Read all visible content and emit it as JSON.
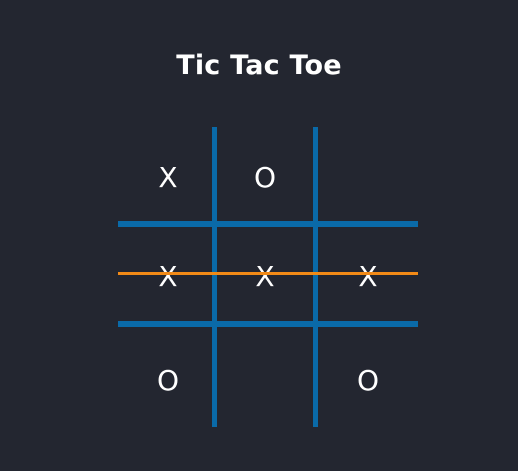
{
  "title": "Tic Tac Toe",
  "colors": {
    "background": "#232630",
    "grid": "#0a6aa8",
    "win_line": "#f28a17",
    "marks": "#ffffff"
  },
  "board": {
    "cells": [
      "X",
      "O",
      "",
      "X",
      "X",
      "X",
      "O",
      "",
      "O"
    ],
    "winning_row": 1,
    "winner": "X"
  }
}
